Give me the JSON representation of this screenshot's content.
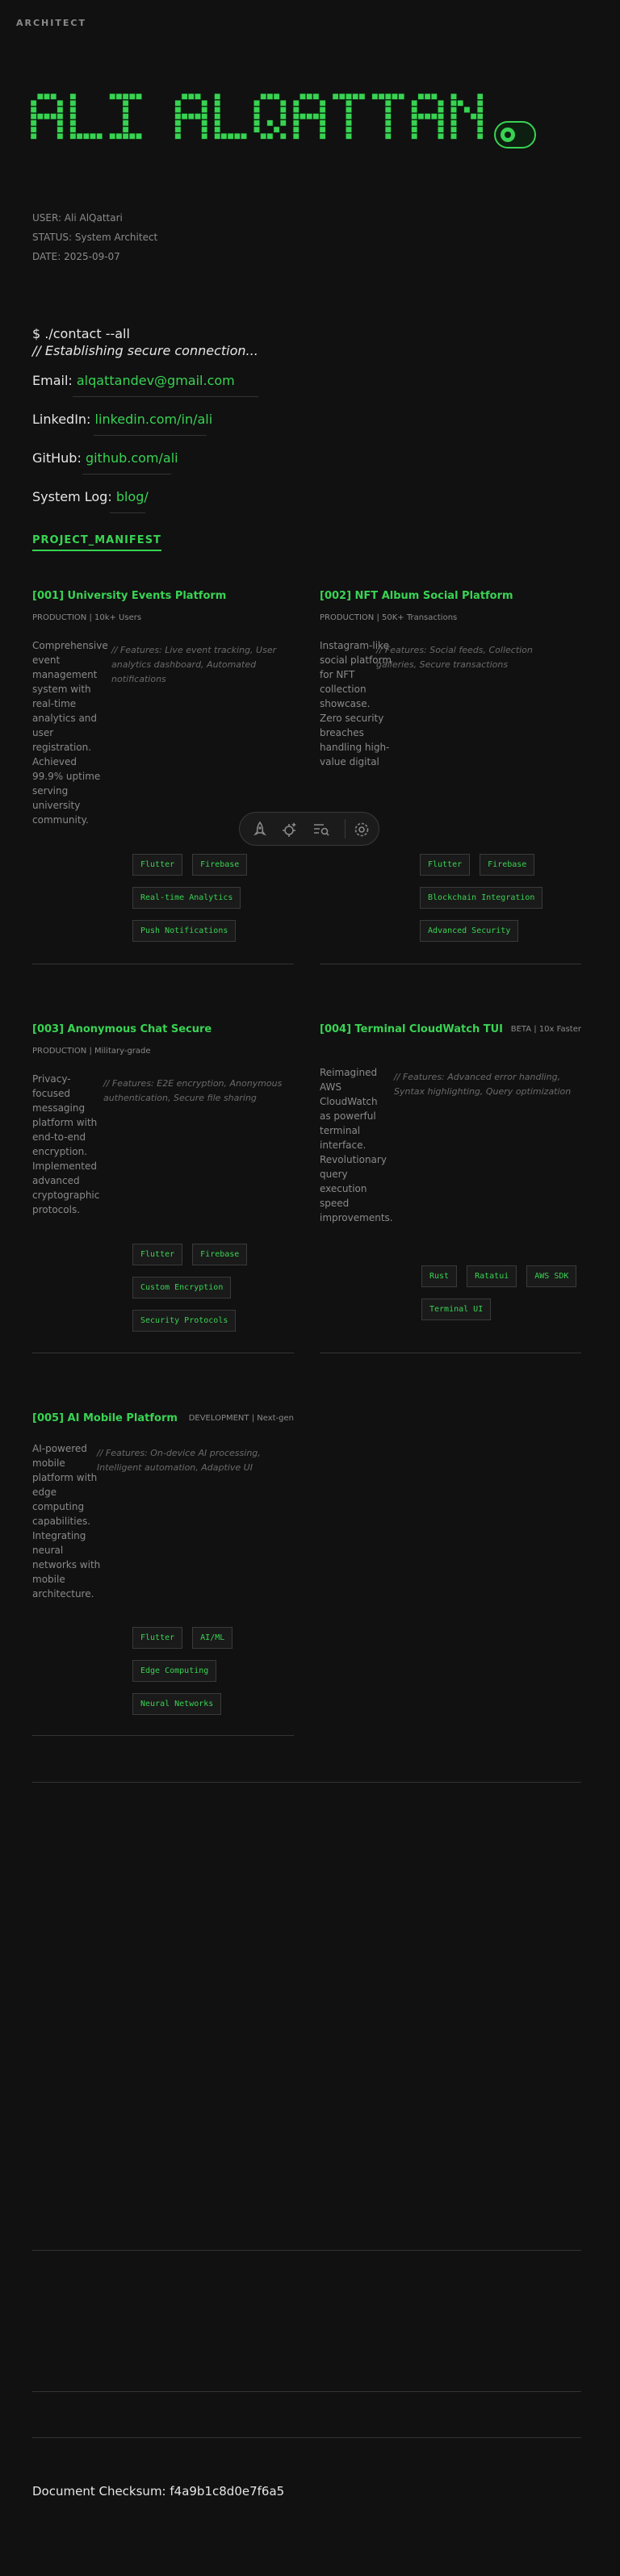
{
  "brand": "ARCHITECT",
  "banner": {
    "name": "ALI ALQATTAN"
  },
  "meta": {
    "user": "USER: Ali AlQattari",
    "status": "STATUS: System Architect",
    "date": "DATE: 2025-09-07"
  },
  "contact": {
    "command": "$ ./contact --all",
    "connecting": "// Establishing secure connection...",
    "rows": [
      {
        "label": "Email:",
        "value": "alqattandev@gmail.com"
      },
      {
        "label": "LinkedIn:",
        "value": "linkedin.com/in/ali"
      },
      {
        "label": "GitHub:",
        "value": "github.com/ali"
      },
      {
        "label": "System Log:",
        "value": "blog/"
      }
    ]
  },
  "manifest_label": "PROJECT_MANIFEST",
  "projects": [
    {
      "title": "[001] University Events Platform",
      "status": "PRODUCTION | 10k+ Users",
      "description": "Comprehensive event management system with real-time analytics and user registration. Achieved 99.9% uptime serving university community.",
      "features": "// Features: Live event tracking, User analytics dashboard, Automated notifications",
      "tags": [
        "Flutter",
        "Firebase",
        "Real-time Analytics",
        "Push Notifications"
      ]
    },
    {
      "title": "[002] NFT Album Social Platform",
      "status": "PRODUCTION | 50K+ Transactions",
      "description": "Instagram-like social platform for NFT collection showcase. Zero security breaches handling high-value digital",
      "features": "// Features: Social feeds, Collection galleries, Secure transactions",
      "tags": [
        "Flutter",
        "Firebase",
        "Blockchain Integration",
        "Advanced Security"
      ]
    },
    {
      "title": "[003] Anonymous Chat Secure",
      "status": "PRODUCTION | Military-grade",
      "description": "Privacy-focused messaging platform with end-to-end encryption. Implemented advanced cryptographic protocols.",
      "features": "// Features: E2E encryption, Anonymous authentication, Secure file sharing",
      "tags": [
        "Flutter",
        "Firebase",
        "Custom Encryption",
        "Security Protocols"
      ]
    },
    {
      "title": "[004] Terminal CloudWatch TUI",
      "badge": "BETA | 10x Faster",
      "description": "Reimagined AWS CloudWatch as powerful terminal interface. Revolutionary query execution speed improvements.",
      "features": "// Features: Advanced error handling, Syntax highlighting, Query optimization",
      "tags": [
        "Rust",
        "Ratatui",
        "AWS SDK",
        "Terminal UI"
      ]
    },
    {
      "title": "[005] AI Mobile Platform",
      "badge": "DEVELOPMENT | Next-gen",
      "description": "AI-powered mobile platform with edge computing capabilities. Integrating neural networks with mobile architecture.",
      "features": "// Features: On-device AI processing, Intelligent automation, Adaptive UI",
      "tags": [
        "Flutter",
        "AI/ML",
        "Edge Computing",
        "Neural Networks"
      ]
    }
  ],
  "toolbar": {
    "icons": [
      "rocket-icon",
      "sparkle-gear-icon",
      "list-search-icon",
      "settings-icon"
    ]
  },
  "checksum": "Document Checksum: f4a9b1c8d0e7f6a5"
}
